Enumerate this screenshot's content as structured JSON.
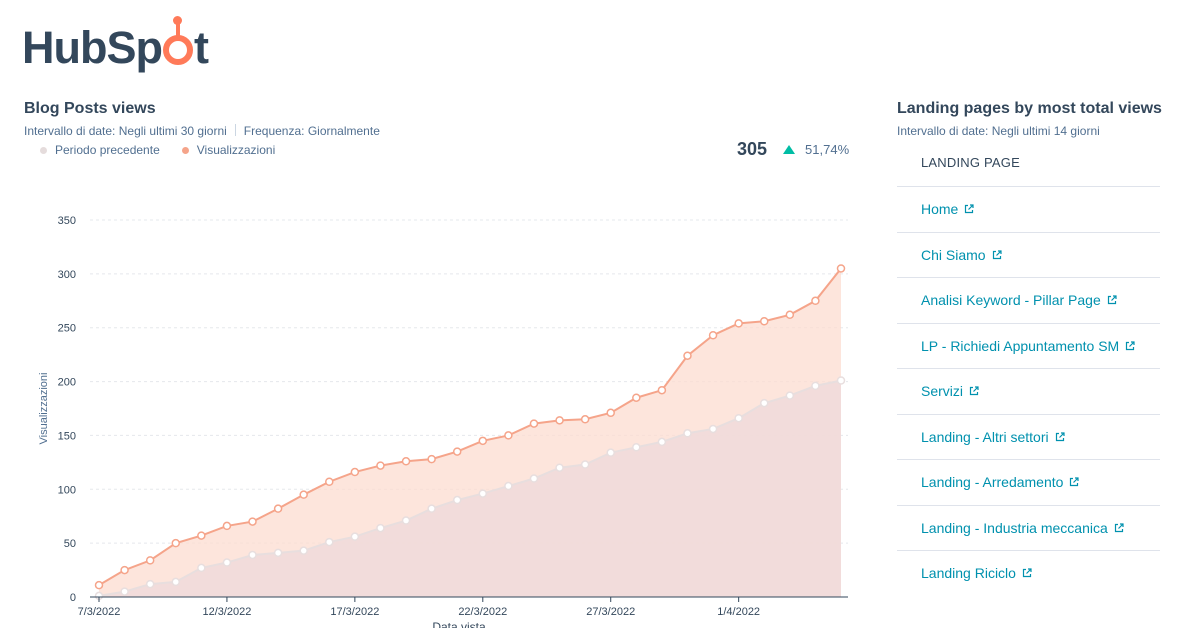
{
  "brand": {
    "name": "HubSpot",
    "part1": "HubSp",
    "part2": "t"
  },
  "left_widget": {
    "title": "Blog Posts views",
    "date_range_label": "Intervallo di date:",
    "date_range_value": "Negli ultimi 30 giorni",
    "frequency_label": "Frequenza:",
    "frequency_value": "Giornalmente",
    "legend": [
      {
        "label": "Periodo precedente",
        "color": "#e5dcdc"
      },
      {
        "label": "Visualizzazioni",
        "color": "#f5a48a"
      }
    ],
    "total": "305",
    "delta": "51,74%",
    "delta_color": "#00bda5"
  },
  "chart_data": {
    "type": "area",
    "xlabel": "Data vista",
    "ylabel": "Visualizzazioni",
    "ylim": [
      0,
      350
    ],
    "yticks": [
      0,
      50,
      100,
      150,
      200,
      250,
      300,
      350
    ],
    "x_tick_labels": [
      "7/3/2022",
      "12/3/2022",
      "17/3/2022",
      "22/3/2022",
      "27/3/2022",
      "1/4/2022"
    ],
    "x": [
      "7/3/2022",
      "8/3/2022",
      "9/3/2022",
      "10/3/2022",
      "11/3/2022",
      "12/3/2022",
      "13/3/2022",
      "14/3/2022",
      "15/3/2022",
      "16/3/2022",
      "17/3/2022",
      "18/3/2022",
      "19/3/2022",
      "20/3/2022",
      "21/3/2022",
      "22/3/2022",
      "23/3/2022",
      "24/3/2022",
      "25/3/2022",
      "26/3/2022",
      "27/3/2022",
      "28/3/2022",
      "29/3/2022",
      "30/3/2022",
      "31/3/2022",
      "1/4/2022",
      "2/4/2022",
      "3/4/2022",
      "4/4/2022",
      "5/4/2022"
    ],
    "series": [
      {
        "name": "Visualizzazioni",
        "color": "#f5a48a",
        "values": [
          11,
          25,
          34,
          50,
          57,
          66,
          70,
          82,
          95,
          107,
          116,
          122,
          126,
          128,
          135,
          145,
          150,
          161,
          164,
          165,
          171,
          185,
          192,
          224,
          243,
          254,
          256,
          262,
          275,
          305
        ]
      },
      {
        "name": "Periodo precedente",
        "color": "#e8dede",
        "values": [
          1,
          5,
          12,
          14,
          27,
          32,
          39,
          41,
          43,
          51,
          56,
          64,
          71,
          82,
          90,
          96,
          103,
          110,
          120,
          123,
          134,
          139,
          144,
          152,
          156,
          166,
          180,
          187,
          196,
          201
        ]
      }
    ],
    "grid": true
  },
  "right_widget": {
    "title": "Landing pages by most total views",
    "date_range_label": "Intervallo di date:",
    "date_range_value": "Negli ultimi 14 giorni",
    "column_header": "LANDING PAGE",
    "rows": [
      "Home",
      "Chi Siamo",
      "Analisi Keyword - Pillar Page",
      "LP - Richiedi Appuntamento SM",
      "Servizi",
      "Landing - Altri settori",
      "Landing - Arredamento",
      "Landing - Industria meccanica",
      "Landing Riciclo"
    ],
    "link_color": "#0091ae"
  }
}
